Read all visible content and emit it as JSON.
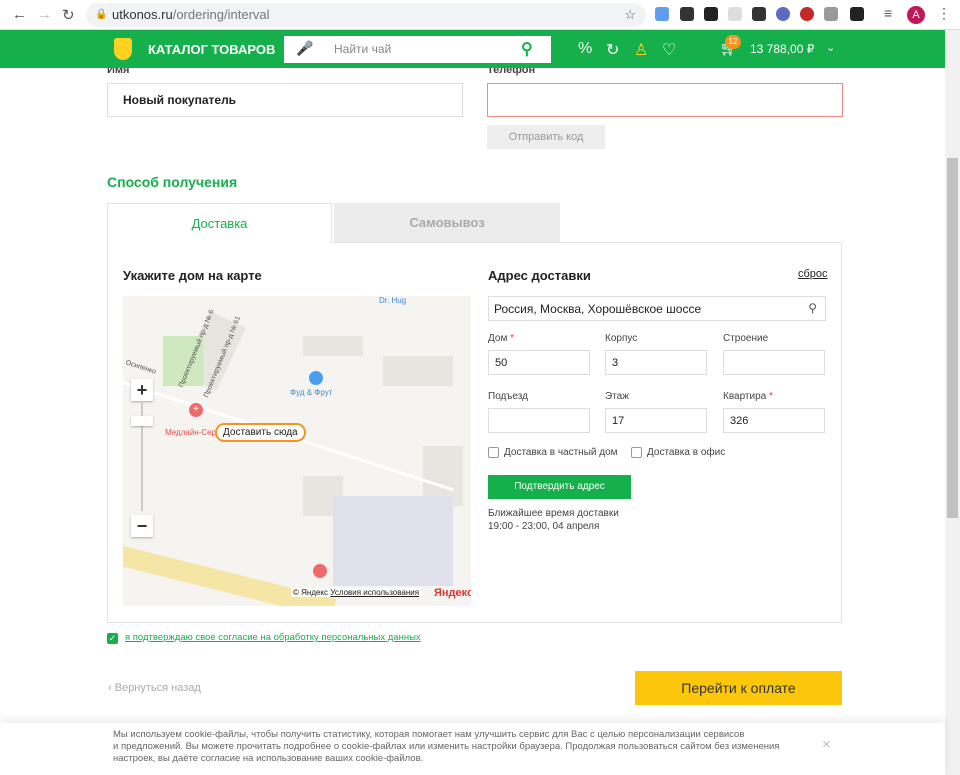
{
  "browser": {
    "url_host": "utkonos.ru",
    "url_path": "/ordering/interval",
    "profile_initial": "A"
  },
  "header": {
    "catalog": "КАТАЛОГ ТОВАРОВ",
    "search_placeholder": "Найти чай",
    "cart_count": "12",
    "cart_total": "13 788,00 ₽",
    "brand_color": "#15b04b"
  },
  "form": {
    "name_label": "Имя",
    "name_value": "Новый покупатель",
    "phone_label": "Телефон",
    "phone_value": "",
    "send_code": "Отправить код"
  },
  "delivery": {
    "title": "Способ получения",
    "tabs": [
      {
        "label": "Доставка",
        "active": true
      },
      {
        "label": "Самовывоз",
        "active": false
      }
    ],
    "map_title": "Укажите дом на карте",
    "map": {
      "pin_label": "Доставить сюда",
      "poi": [
        "Dr. Hug",
        "Фуд & Фрут",
        "Медлайн-Сер"
      ],
      "streets": [
        "Проектируемый пр-д № 6",
        "Проектируемый пр-д № 61",
        "Осипенко"
      ],
      "copyright": "© Яндекс",
      "terms": "Условия использования",
      "logo": "Яндекс"
    },
    "address_title": "Адрес доставки",
    "reset": "сброс",
    "address_value": "Россия, Москва, Хорошёвское шоссе",
    "fields": [
      {
        "label": "Дом",
        "required": true,
        "value": "50"
      },
      {
        "label": "Корпус",
        "required": false,
        "value": "3"
      },
      {
        "label": "Строение",
        "required": false,
        "value": ""
      },
      {
        "label": "Подъезд",
        "required": false,
        "value": ""
      },
      {
        "label": "Этаж",
        "required": false,
        "value": "17"
      },
      {
        "label": "Квартира",
        "required": true,
        "value": "326"
      }
    ],
    "private_house": "Доставка в частный дом",
    "office": "Доставка в офис",
    "confirm": "Подтвердить адрес",
    "nearest_label": "Ближайшее время доставки",
    "nearest_value": "19:00 - 23:00, 04 апреля"
  },
  "consent": "я подтверждаю свое согласие на обработку персональных данных",
  "back": "Вернуться назад",
  "pay": "Перейти к оплате",
  "cookie": {
    "line1": "Мы используем cookie-файлы, чтобы получить статистику, которая помогает нам улучшить сервис для Вас с целью персонализации сервисов",
    "line2": "и предложений. Вы можете прочитать подробнее о cookie-файлах или изменить настройки браузера. Продолжая пользоваться сайтом без изменения",
    "line3": "настроек, вы даёте согласие на использование ваших cookie-файлов.",
    "close": "×"
  }
}
